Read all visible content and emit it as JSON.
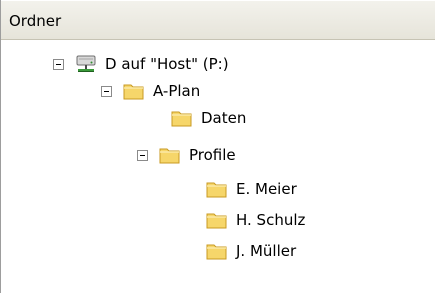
{
  "header": {
    "title": "Ordner"
  },
  "tree": {
    "items": [
      {
        "label": "D auf \"Host\" (P:)",
        "icon": "network-drive-icon",
        "expanded": true
      },
      {
        "label": "A-Plan",
        "icon": "folder-icon",
        "expanded": true
      },
      {
        "label": "Daten",
        "icon": "folder-icon",
        "expanded": false
      },
      {
        "label": "Profile",
        "icon": "folder-icon",
        "expanded": true
      },
      {
        "label": "E. Meier",
        "icon": "folder-icon",
        "expanded": false
      },
      {
        "label": "H. Schulz",
        "icon": "folder-icon",
        "expanded": false
      },
      {
        "label": "J. Müller",
        "icon": "folder-icon",
        "expanded": false
      }
    ]
  },
  "colors": {
    "header_bg": "#ece9d8",
    "folder_yellow": "#f6d66a",
    "folder_outline": "#c89a21"
  }
}
